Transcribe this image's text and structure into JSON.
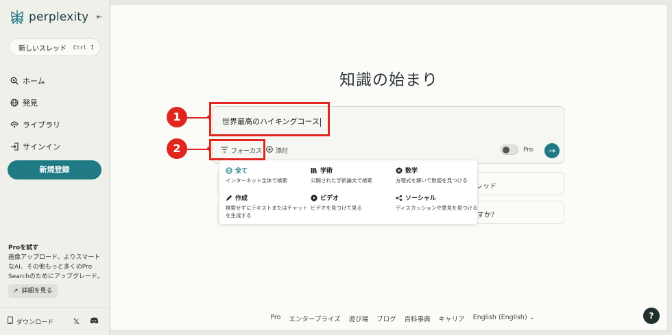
{
  "sidebar": {
    "logo_text": "perplexity",
    "new_thread": {
      "label": "新しいスレッド",
      "kbd": [
        "Ctrl",
        "I"
      ]
    },
    "nav": [
      {
        "label": "ホーム",
        "icon": "home-search-icon"
      },
      {
        "label": "発見",
        "icon": "globe-icon"
      },
      {
        "label": "ライブラリ",
        "icon": "library-icon"
      },
      {
        "label": "サインイン",
        "icon": "sign-in-icon"
      }
    ],
    "signup_label": "新規登録",
    "pro": {
      "title": "Proを試す",
      "desc": "画像アップロード、よりスマートなAI、その他もっと多くのPro Searchのためにアップグレード。",
      "learn_more": "詳細を見る"
    },
    "download_label": "ダウンロード"
  },
  "main": {
    "headline": "知識の始まり",
    "search": {
      "query": "世界最高のハイキングコース",
      "focus_label": "フォーカス",
      "attach_label": "添付",
      "pro_label": "Pro"
    },
    "suggestions": [
      "レッド",
      "すか？"
    ],
    "focus_menu": [
      {
        "title": "全て",
        "desc": "インターネット全体で検索",
        "icon": "globe-icon",
        "active": true
      },
      {
        "title": "学術",
        "desc": "公開された学術論文で検索",
        "icon": "books-icon",
        "active": false
      },
      {
        "title": "数学",
        "desc": "方程式を解いて数値を見つける",
        "icon": "math-icon",
        "active": false
      },
      {
        "title": "作成",
        "desc": "検索せずにテキストまたはチャットを生成する",
        "icon": "pen-icon",
        "active": false
      },
      {
        "title": "ビデオ",
        "desc": "ビデオを見つけて見る",
        "icon": "play-icon",
        "active": false
      },
      {
        "title": "ソーシャル",
        "desc": "ディスカッションや意見を見つける",
        "icon": "social-icon",
        "active": false
      }
    ],
    "footer_links": [
      "Pro",
      "エンタープライズ",
      "遊び場",
      "ブログ",
      "百科事典",
      "キャリア",
      "English (English)"
    ],
    "help_label": "?"
  },
  "callouts": [
    "1",
    "2"
  ],
  "colors": {
    "accent": "#1f7a86",
    "callout": "#e0261f"
  }
}
